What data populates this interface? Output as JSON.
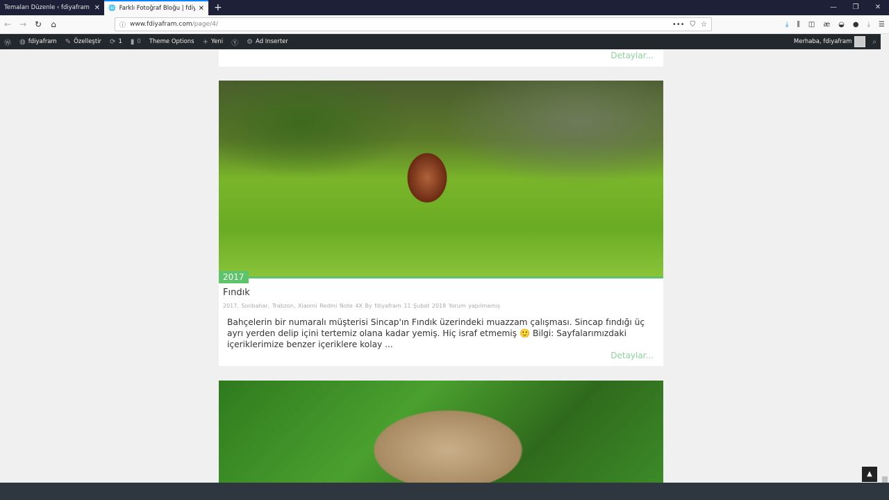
{
  "browser": {
    "tabs": [
      {
        "label": "Temaları Düzenle ‹ fdiyafram — WordPress"
      },
      {
        "label": "Farklı Fotoğraf Bloğu | fdiyafram"
      }
    ],
    "url_domain": "www.fdiyafram.com",
    "url_path": "/page/4/"
  },
  "admin_bar": {
    "site": "fdiyafram",
    "customize": "Özelleştir",
    "updates": "1",
    "comments": "0",
    "theme_options": "Theme Options",
    "new": "Yeni",
    "ad_inserter": "Ad Inserter",
    "greeting": "Merhaba, fdiyafram"
  },
  "prev_post": {
    "more": "Detaylar..."
  },
  "post": {
    "year_badge": "2017",
    "title": "Fındık",
    "meta": "2017, Sonbahar, Trabzon, Xiaomi Redmi Note 4X  By fdiyafram  11 Şubat 2018  Yorum yapılmamış",
    "excerpt": "Bahçelerin bir numaralı müşterisi Sincap'ın Fındık üzerindeki muazzam çalışması. Sincap fındığı üç ayrı yerden delip içini tertemiz olana kadar yemiş. Hiç israf etmemiş 🙂 Bilgi: Sayfalarımızdaki içeriklerimize benzer içeriklere kolay ...",
    "more": "Detaylar..."
  },
  "colors": {
    "accent": "#5ec46a",
    "admin_bar": "#23282d"
  }
}
